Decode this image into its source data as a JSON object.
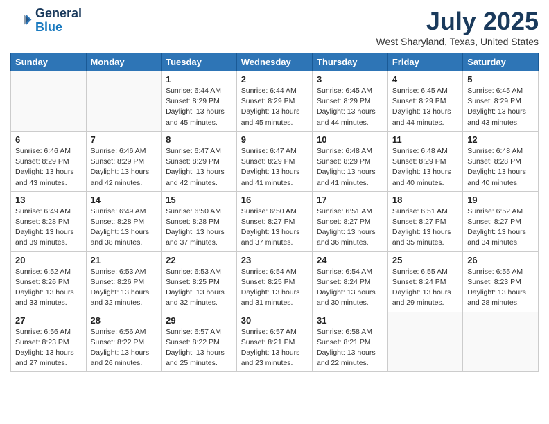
{
  "header": {
    "logo": {
      "line1": "General",
      "line2": "Blue"
    },
    "month": "July 2025",
    "location": "West Sharyland, Texas, United States"
  },
  "weekdays": [
    "Sunday",
    "Monday",
    "Tuesday",
    "Wednesday",
    "Thursday",
    "Friday",
    "Saturday"
  ],
  "weeks": [
    [
      {
        "day": "",
        "info": ""
      },
      {
        "day": "",
        "info": ""
      },
      {
        "day": "1",
        "info": "Sunrise: 6:44 AM\nSunset: 8:29 PM\nDaylight: 13 hours\nand 45 minutes."
      },
      {
        "day": "2",
        "info": "Sunrise: 6:44 AM\nSunset: 8:29 PM\nDaylight: 13 hours\nand 45 minutes."
      },
      {
        "day": "3",
        "info": "Sunrise: 6:45 AM\nSunset: 8:29 PM\nDaylight: 13 hours\nand 44 minutes."
      },
      {
        "day": "4",
        "info": "Sunrise: 6:45 AM\nSunset: 8:29 PM\nDaylight: 13 hours\nand 44 minutes."
      },
      {
        "day": "5",
        "info": "Sunrise: 6:45 AM\nSunset: 8:29 PM\nDaylight: 13 hours\nand 43 minutes."
      }
    ],
    [
      {
        "day": "6",
        "info": "Sunrise: 6:46 AM\nSunset: 8:29 PM\nDaylight: 13 hours\nand 43 minutes."
      },
      {
        "day": "7",
        "info": "Sunrise: 6:46 AM\nSunset: 8:29 PM\nDaylight: 13 hours\nand 42 minutes."
      },
      {
        "day": "8",
        "info": "Sunrise: 6:47 AM\nSunset: 8:29 PM\nDaylight: 13 hours\nand 42 minutes."
      },
      {
        "day": "9",
        "info": "Sunrise: 6:47 AM\nSunset: 8:29 PM\nDaylight: 13 hours\nand 41 minutes."
      },
      {
        "day": "10",
        "info": "Sunrise: 6:48 AM\nSunset: 8:29 PM\nDaylight: 13 hours\nand 41 minutes."
      },
      {
        "day": "11",
        "info": "Sunrise: 6:48 AM\nSunset: 8:29 PM\nDaylight: 13 hours\nand 40 minutes."
      },
      {
        "day": "12",
        "info": "Sunrise: 6:48 AM\nSunset: 8:28 PM\nDaylight: 13 hours\nand 40 minutes."
      }
    ],
    [
      {
        "day": "13",
        "info": "Sunrise: 6:49 AM\nSunset: 8:28 PM\nDaylight: 13 hours\nand 39 minutes."
      },
      {
        "day": "14",
        "info": "Sunrise: 6:49 AM\nSunset: 8:28 PM\nDaylight: 13 hours\nand 38 minutes."
      },
      {
        "day": "15",
        "info": "Sunrise: 6:50 AM\nSunset: 8:28 PM\nDaylight: 13 hours\nand 37 minutes."
      },
      {
        "day": "16",
        "info": "Sunrise: 6:50 AM\nSunset: 8:27 PM\nDaylight: 13 hours\nand 37 minutes."
      },
      {
        "day": "17",
        "info": "Sunrise: 6:51 AM\nSunset: 8:27 PM\nDaylight: 13 hours\nand 36 minutes."
      },
      {
        "day": "18",
        "info": "Sunrise: 6:51 AM\nSunset: 8:27 PM\nDaylight: 13 hours\nand 35 minutes."
      },
      {
        "day": "19",
        "info": "Sunrise: 6:52 AM\nSunset: 8:27 PM\nDaylight: 13 hours\nand 34 minutes."
      }
    ],
    [
      {
        "day": "20",
        "info": "Sunrise: 6:52 AM\nSunset: 8:26 PM\nDaylight: 13 hours\nand 33 minutes."
      },
      {
        "day": "21",
        "info": "Sunrise: 6:53 AM\nSunset: 8:26 PM\nDaylight: 13 hours\nand 32 minutes."
      },
      {
        "day": "22",
        "info": "Sunrise: 6:53 AM\nSunset: 8:25 PM\nDaylight: 13 hours\nand 32 minutes."
      },
      {
        "day": "23",
        "info": "Sunrise: 6:54 AM\nSunset: 8:25 PM\nDaylight: 13 hours\nand 31 minutes."
      },
      {
        "day": "24",
        "info": "Sunrise: 6:54 AM\nSunset: 8:24 PM\nDaylight: 13 hours\nand 30 minutes."
      },
      {
        "day": "25",
        "info": "Sunrise: 6:55 AM\nSunset: 8:24 PM\nDaylight: 13 hours\nand 29 minutes."
      },
      {
        "day": "26",
        "info": "Sunrise: 6:55 AM\nSunset: 8:23 PM\nDaylight: 13 hours\nand 28 minutes."
      }
    ],
    [
      {
        "day": "27",
        "info": "Sunrise: 6:56 AM\nSunset: 8:23 PM\nDaylight: 13 hours\nand 27 minutes."
      },
      {
        "day": "28",
        "info": "Sunrise: 6:56 AM\nSunset: 8:22 PM\nDaylight: 13 hours\nand 26 minutes."
      },
      {
        "day": "29",
        "info": "Sunrise: 6:57 AM\nSunset: 8:22 PM\nDaylight: 13 hours\nand 25 minutes."
      },
      {
        "day": "30",
        "info": "Sunrise: 6:57 AM\nSunset: 8:21 PM\nDaylight: 13 hours\nand 23 minutes."
      },
      {
        "day": "31",
        "info": "Sunrise: 6:58 AM\nSunset: 8:21 PM\nDaylight: 13 hours\nand 22 minutes."
      },
      {
        "day": "",
        "info": ""
      },
      {
        "day": "",
        "info": ""
      }
    ]
  ]
}
